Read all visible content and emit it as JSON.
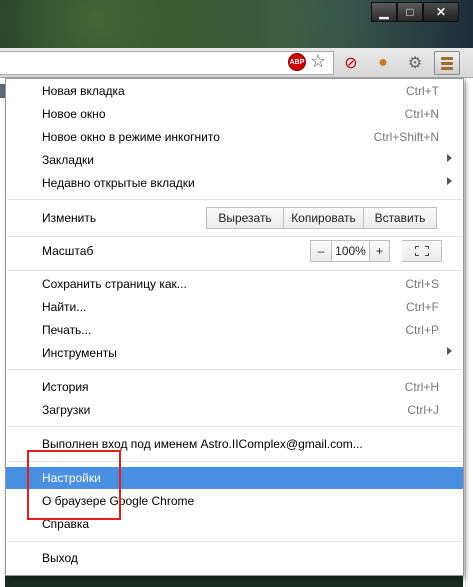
{
  "window": {
    "minimize_glyph": "▁",
    "maximize_glyph": "□",
    "close_glyph": "✕"
  },
  "toolbar": {
    "abp_label": "ABP",
    "star_glyph": "☆",
    "ext_glyphs": [
      "⊘",
      "●",
      "⚙"
    ]
  },
  "menu": {
    "new_tab": {
      "label": "Новая вкладка",
      "shortcut": "Ctrl+T"
    },
    "new_window": {
      "label": "Новое окно",
      "shortcut": "Ctrl+N"
    },
    "incognito": {
      "label": "Новое окно в режиме инкогнито",
      "shortcut": "Ctrl+Shift+N"
    },
    "bookmarks": {
      "label": "Закладки"
    },
    "recent_tabs": {
      "label": "Недавно открытые вкладки"
    },
    "edit": {
      "label": "Изменить",
      "cut": "Вырезать",
      "copy": "Копировать",
      "paste": "Вставить"
    },
    "zoom": {
      "label": "Масштаб",
      "minus": "–",
      "value": "100%",
      "plus": "+"
    },
    "save_page": {
      "label": "Сохранить страницу как...",
      "shortcut": "Ctrl+S"
    },
    "find": {
      "label": "Найти...",
      "shortcut": "Ctrl+F"
    },
    "print": {
      "label": "Печать...",
      "shortcut": "Ctrl+P"
    },
    "tools": {
      "label": "Инструменты"
    },
    "history": {
      "label": "История",
      "shortcut": "Ctrl+H"
    },
    "downloads": {
      "label": "Загрузки",
      "shortcut": "Ctrl+J"
    },
    "signed_in": {
      "label": "Выполнен вход под именем Astro.IIComplex@gmail.com..."
    },
    "settings": {
      "label": "Настройки"
    },
    "about": {
      "label": "О браузере Google Chrome"
    },
    "help": {
      "label": "Справка"
    },
    "exit": {
      "label": "Выход"
    }
  },
  "colors": {
    "highlight": "#4a90e2",
    "annotation_box": "#e0201e"
  }
}
